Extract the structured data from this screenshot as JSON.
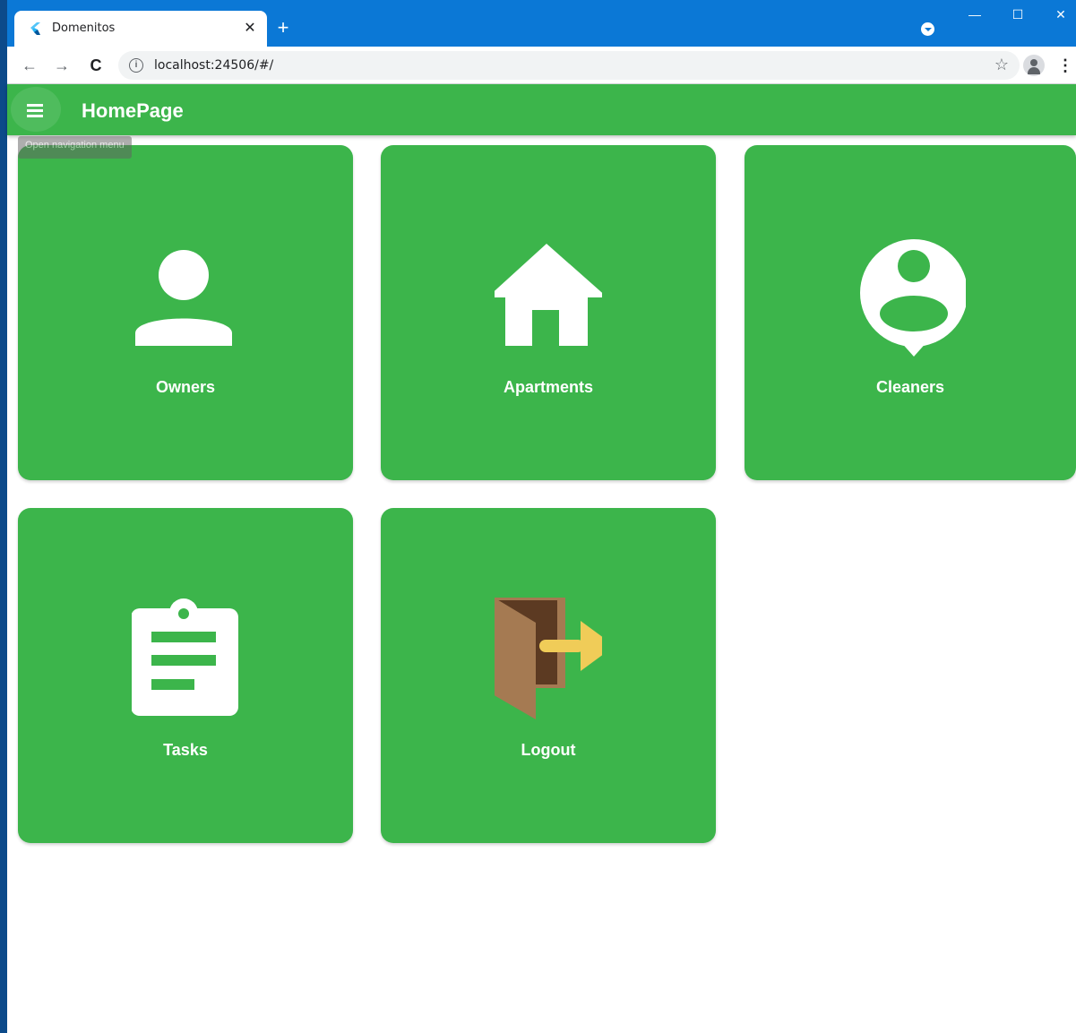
{
  "browser": {
    "tab_title": "Domenitos",
    "tab_close_glyph": "✕",
    "new_tab_glyph": "+",
    "url": "localhost:24506/#/",
    "info_glyph": "i",
    "star_glyph": "☆",
    "back_glyph": "←",
    "forward_glyph": "→",
    "reload_glyph": "C",
    "menu_glyph": "⋮",
    "window_min_glyph": "—",
    "window_max_glyph": "☐",
    "window_close_glyph": "✕",
    "tab_bar_color": "#0b78d6"
  },
  "app": {
    "title": "HomePage",
    "tooltip": "Open navigation menu",
    "primary_color": "#3cb54b"
  },
  "tiles": [
    {
      "label": "Owners",
      "icon": "person-icon"
    },
    {
      "label": "Apartments",
      "icon": "house-icon"
    },
    {
      "label": "Cleaners",
      "icon": "person-pin-icon"
    },
    {
      "label": "Tasks",
      "icon": "clipboard-icon"
    },
    {
      "label": "Logout",
      "icon": "door-exit-icon"
    }
  ]
}
